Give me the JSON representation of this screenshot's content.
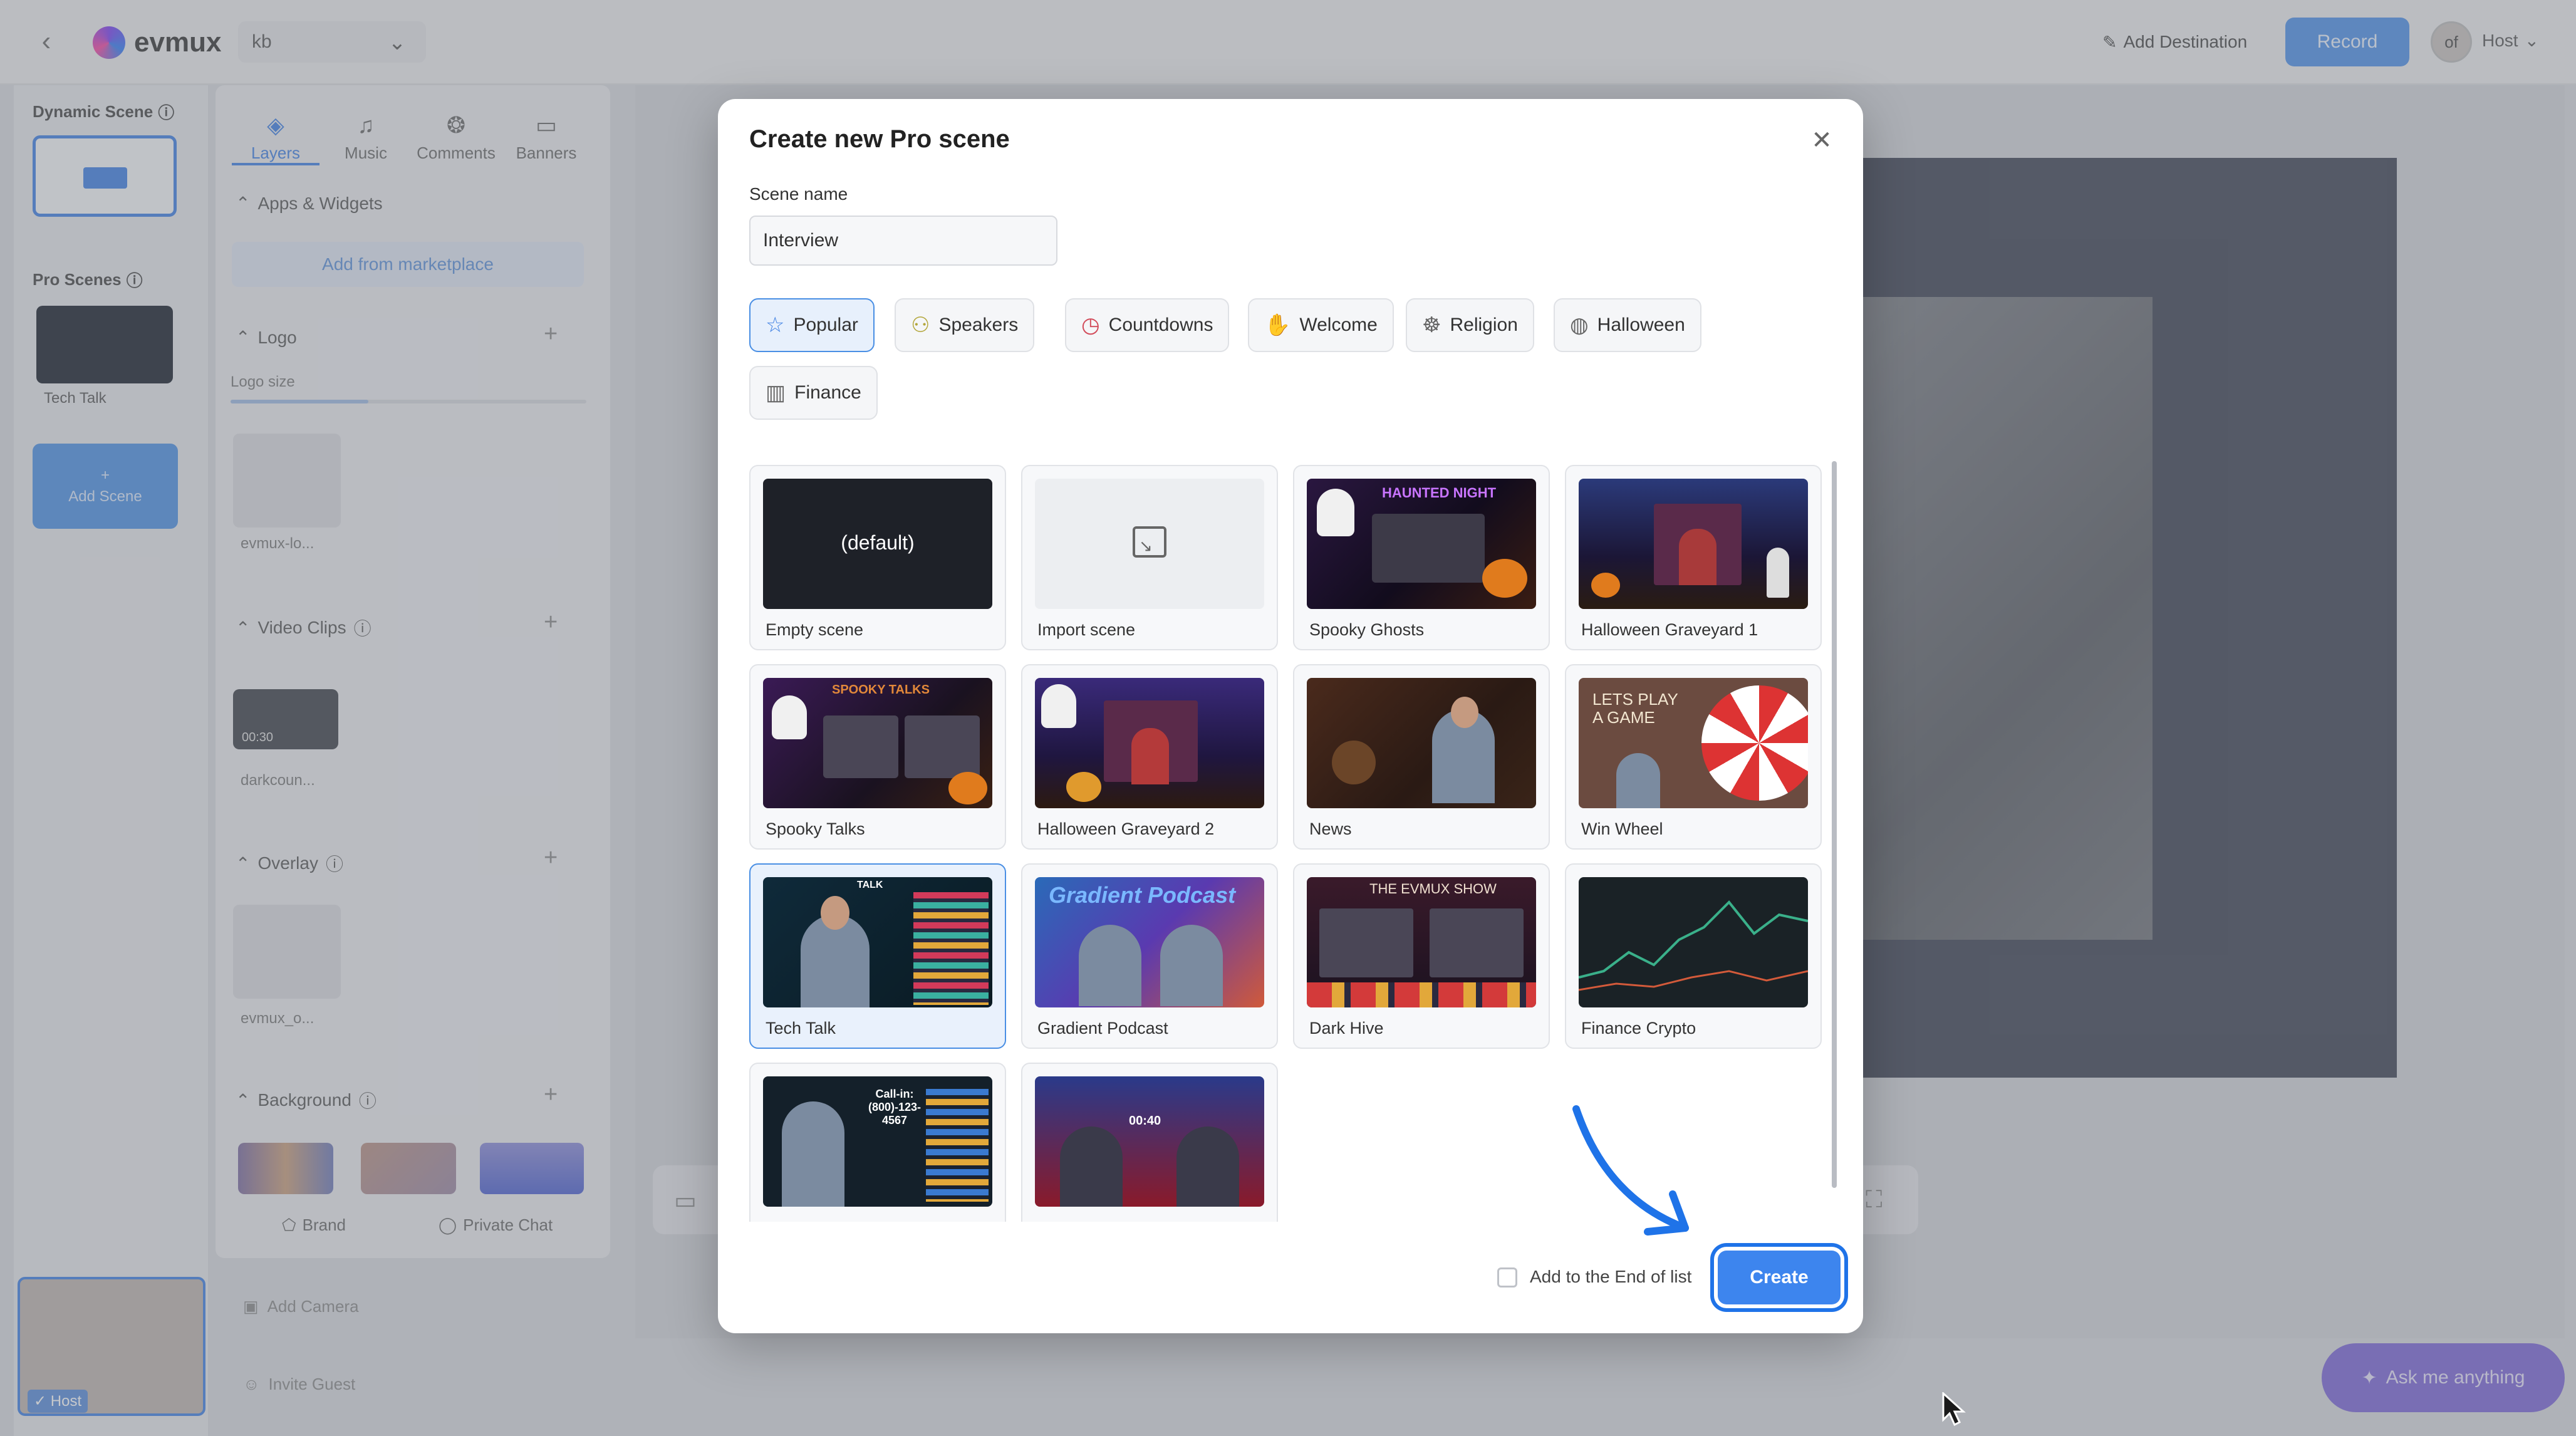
{
  "topbar": {
    "logo_text": "evmux",
    "studio_name": "kb",
    "add_destination": "Add Destination",
    "record": "Record",
    "avatar_initials": "of",
    "host": "Host"
  },
  "left": {
    "dynamic_scene": "Dynamic Scene",
    "pro_scenes": "Pro Scenes",
    "pro_scene_item": "Tech Talk",
    "add_scene": "Add Scene",
    "host_label": "Host"
  },
  "panel": {
    "tabs": [
      {
        "label": "Layers",
        "icon": "layers-icon"
      },
      {
        "label": "Music",
        "icon": "music-icon"
      },
      {
        "label": "Comments",
        "icon": "comments-icon"
      },
      {
        "label": "Banners",
        "icon": "banner-icon"
      }
    ],
    "apps_widgets": "Apps & Widgets",
    "add_from_marketplace": "Add from marketplace",
    "logo": "Logo",
    "logo_size": "Logo size",
    "logo_item": "evmux-lo...",
    "video_clips": "Video Clips",
    "video_clip_item": "darkcoun...",
    "video_clip_duration": "00:30",
    "overlay": "Overlay",
    "overlay_item": "evmux_o...",
    "background": "Background",
    "brand": "Brand",
    "private_chat": "Private Chat"
  },
  "stage": {
    "add_camera": "Add Camera",
    "invite_guest": "Invite Guest",
    "ask_me_anything": "Ask me anything"
  },
  "modal": {
    "title": "Create new Pro scene",
    "scene_name_label": "Scene name",
    "scene_name_value": "Interview",
    "categories": [
      {
        "label": "Popular",
        "icon": "star-icon",
        "active": true
      },
      {
        "label": "Speakers",
        "icon": "speakers-icon",
        "active": false
      },
      {
        "label": "Countdowns",
        "icon": "clock-icon",
        "active": false
      },
      {
        "label": "Welcome",
        "icon": "wave-hand-icon",
        "active": false
      },
      {
        "label": "Religion",
        "icon": "religion-icon",
        "active": false
      },
      {
        "label": "Halloween",
        "icon": "pumpkin-icon",
        "active": false
      },
      {
        "label": "Finance",
        "icon": "finance-chart-icon",
        "active": false
      }
    ],
    "templates": [
      {
        "label": "Empty scene",
        "thumb_text": "(default)"
      },
      {
        "label": "Import scene"
      },
      {
        "label": "Spooky Ghosts",
        "thumb_text": "HAUNTED NIGHT"
      },
      {
        "label": "Halloween Graveyard 1"
      },
      {
        "label": "Spooky Talks",
        "thumb_text": "SPOOKY TALKS"
      },
      {
        "label": "Halloween Graveyard 2"
      },
      {
        "label": "News"
      },
      {
        "label": "Win Wheel",
        "thumb_text": "LETS PLAY A GAME"
      },
      {
        "label": "Tech Talk",
        "thumb_text": "TALK",
        "selected": true
      },
      {
        "label": "Gradient Podcast",
        "thumb_text": "Gradient Podcast"
      },
      {
        "label": "Dark Hive",
        "thumb_text": "THE EVMUX SHOW"
      },
      {
        "label": "Finance Crypto"
      },
      {
        "label": "",
        "thumb_text": "Call-in: (800)-123-4567"
      },
      {
        "label": "",
        "thumb_text": "00:40"
      }
    ],
    "add_to_end": "Add to the End of list",
    "create": "Create"
  }
}
